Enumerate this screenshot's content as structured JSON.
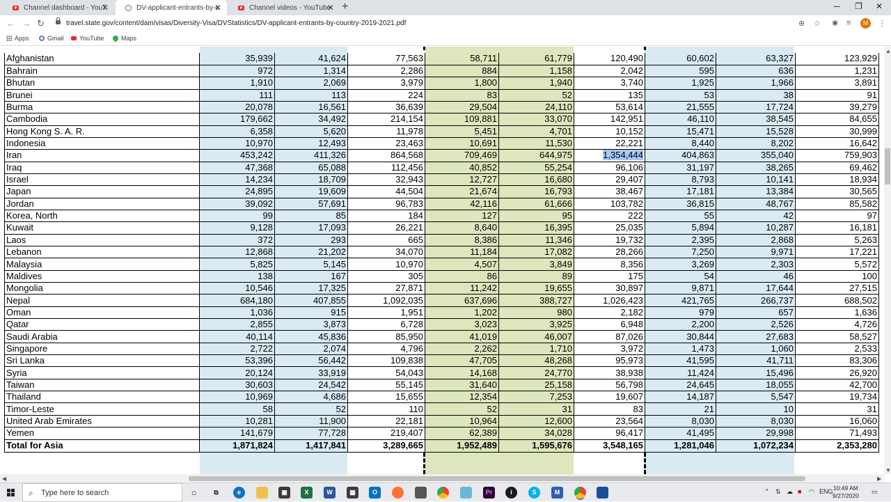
{
  "browser": {
    "tabs": [
      {
        "title": "Channel dashboard - YouTube Studio",
        "icon": "youtube-icon",
        "active": false
      },
      {
        "title": "DV-applicant-entrants-by-country",
        "icon": "globe-icon",
        "active": true
      },
      {
        "title": "Channel videos - YouTube Studio",
        "icon": "youtube-icon",
        "active": false
      }
    ],
    "url": "travel.state.gov/content/dam/visas/Diversity-Visa/DVStatistics/DV-applicant-entrants-by-country-2019-2021.pdf",
    "profile_initial": "M",
    "bookmarks": [
      {
        "label": "Apps",
        "icon": "apps-grid-icon"
      },
      {
        "label": "Gmail",
        "icon": "google-icon"
      },
      {
        "label": "YouTube",
        "icon": "youtube-icon"
      },
      {
        "label": "Maps",
        "icon": "maps-pin-icon"
      }
    ]
  },
  "table": {
    "rows": [
      {
        "country": "Afghanistan",
        "values": [
          "35,939",
          "41,624",
          "77,563",
          "58,711",
          "61,779",
          "120,490",
          "60,602",
          "63,327",
          "123,929"
        ]
      },
      {
        "country": "Bahrain",
        "values": [
          "972",
          "1,314",
          "2,286",
          "884",
          "1,158",
          "2,042",
          "595",
          "636",
          "1,231"
        ]
      },
      {
        "country": "Bhutan",
        "values": [
          "1,910",
          "2,069",
          "3,979",
          "1,800",
          "1,940",
          "3,740",
          "1,925",
          "1,966",
          "3,891"
        ]
      },
      {
        "country": "Brunei",
        "values": [
          "111",
          "113",
          "224",
          "83",
          "52",
          "135",
          "53",
          "38",
          "91"
        ]
      },
      {
        "country": "Burma",
        "values": [
          "20,078",
          "16,561",
          "36,639",
          "29,504",
          "24,110",
          "53,614",
          "21,555",
          "17,724",
          "39,279"
        ]
      },
      {
        "country": "Cambodia",
        "values": [
          "179,662",
          "34,492",
          "214,154",
          "109,881",
          "33,070",
          "142,951",
          "46,110",
          "38,545",
          "84,655"
        ]
      },
      {
        "country": "Hong Kong S. A. R.",
        "values": [
          "6,358",
          "5,620",
          "11,978",
          "5,451",
          "4,701",
          "10,152",
          "15,471",
          "15,528",
          "30,999"
        ]
      },
      {
        "country": "Indonesia",
        "values": [
          "10,970",
          "12,493",
          "23,463",
          "10,691",
          "11,530",
          "22,221",
          "8,440",
          "8,202",
          "16,642"
        ]
      },
      {
        "country": "Iran",
        "values": [
          "453,242",
          "411,326",
          "864,568",
          "709,469",
          "644,975",
          "1,354,444",
          "404,863",
          "355,040",
          "759,903"
        ]
      },
      {
        "country": "Iraq",
        "values": [
          "47,368",
          "65,088",
          "112,456",
          "40,852",
          "55,254",
          "96,106",
          "31,197",
          "38,265",
          "69,462"
        ]
      },
      {
        "country": "Israel",
        "values": [
          "14,234",
          "18,709",
          "32,943",
          "12,727",
          "16,680",
          "29,407",
          "8,793",
          "10,141",
          "18,934"
        ]
      },
      {
        "country": "Japan",
        "values": [
          "24,895",
          "19,609",
          "44,504",
          "21,674",
          "16,793",
          "38,467",
          "17,181",
          "13,384",
          "30,565"
        ]
      },
      {
        "country": "Jordan",
        "values": [
          "39,092",
          "57,691",
          "96,783",
          "42,116",
          "61,666",
          "103,782",
          "36,815",
          "48,767",
          "85,582"
        ]
      },
      {
        "country": "Korea, North",
        "values": [
          "99",
          "85",
          "184",
          "127",
          "95",
          "222",
          "55",
          "42",
          "97"
        ]
      },
      {
        "country": "Kuwait",
        "values": [
          "9,128",
          "17,093",
          "26,221",
          "8,640",
          "16,395",
          "25,035",
          "5,894",
          "10,287",
          "16,181"
        ]
      },
      {
        "country": "Laos",
        "values": [
          "372",
          "293",
          "665",
          "8,386",
          "11,346",
          "19,732",
          "2,395",
          "2,868",
          "5,263"
        ]
      },
      {
        "country": "Lebanon",
        "values": [
          "12,868",
          "21,202",
          "34,070",
          "11,184",
          "17,082",
          "28,266",
          "7,250",
          "9,971",
          "17,221"
        ]
      },
      {
        "country": "Malaysia",
        "values": [
          "5,825",
          "5,145",
          "10,970",
          "4,507",
          "3,849",
          "8,356",
          "3,269",
          "2,303",
          "5,572"
        ]
      },
      {
        "country": "Maldives",
        "values": [
          "138",
          "167",
          "305",
          "86",
          "89",
          "175",
          "54",
          "46",
          "100"
        ]
      },
      {
        "country": "Mongolia",
        "values": [
          "10,546",
          "17,325",
          "27,871",
          "11,242",
          "19,655",
          "30,897",
          "9,871",
          "17,644",
          "27,515"
        ]
      },
      {
        "country": "Nepal",
        "values": [
          "684,180",
          "407,855",
          "1,092,035",
          "637,696",
          "388,727",
          "1,026,423",
          "421,765",
          "266,737",
          "688,502"
        ]
      },
      {
        "country": "Oman",
        "values": [
          "1,036",
          "915",
          "1,951",
          "1,202",
          "980",
          "2,182",
          "979",
          "657",
          "1,636"
        ]
      },
      {
        "country": "Qatar",
        "values": [
          "2,855",
          "3,873",
          "6,728",
          "3,023",
          "3,925",
          "6,948",
          "2,200",
          "2,526",
          "4,726"
        ]
      },
      {
        "country": "Saudi Arabia",
        "values": [
          "40,114",
          "45,836",
          "85,950",
          "41,019",
          "46,007",
          "87,026",
          "30,844",
          "27,683",
          "58,527"
        ]
      },
      {
        "country": "Singapore",
        "values": [
          "2,722",
          "2,074",
          "4,796",
          "2,262",
          "1,710",
          "3,972",
          "1,473",
          "1,060",
          "2,533"
        ]
      },
      {
        "country": "Sri Lanka",
        "values": [
          "53,396",
          "56,442",
          "109,838",
          "47,705",
          "48,268",
          "95,973",
          "41,595",
          "41,711",
          "83,306"
        ]
      },
      {
        "country": "Syria",
        "values": [
          "20,124",
          "33,919",
          "54,043",
          "14,168",
          "24,770",
          "38,938",
          "11,424",
          "15,496",
          "26,920"
        ]
      },
      {
        "country": "Taiwan",
        "values": [
          "30,603",
          "24,542",
          "55,145",
          "31,640",
          "25,158",
          "56,798",
          "24,645",
          "18,055",
          "42,700"
        ]
      },
      {
        "country": "Thailand",
        "values": [
          "10,969",
          "4,686",
          "15,655",
          "12,354",
          "7,253",
          "19,607",
          "14,187",
          "5,547",
          "19,734"
        ]
      },
      {
        "country": "Timor-Leste",
        "values": [
          "58",
          "52",
          "110",
          "52",
          "31",
          "83",
          "21",
          "10",
          "31"
        ]
      },
      {
        "country": "United Arab Emirates",
        "values": [
          "10,281",
          "11,900",
          "22,181",
          "10,964",
          "12,600",
          "23,564",
          "8,030",
          "8,030",
          "16,060"
        ]
      },
      {
        "country": "Yemen",
        "values": [
          "141,679",
          "77,728",
          "219,407",
          "62,389",
          "34,028",
          "96,417",
          "41,495",
          "29,998",
          "71,493"
        ]
      }
    ],
    "total": {
      "country": "Total for Asia",
      "values": [
        "1,871,824",
        "1,417,841",
        "3,289,665",
        "1,952,489",
        "1,595,676",
        "3,548,165",
        "1,281,046",
        "1,072,234",
        "2,353,280"
      ]
    },
    "selected_cell": "1,354,444",
    "colors": {
      "blue_band": "#daeaf3",
      "green_band": "#dde6bd",
      "selection": "#a8c7fa"
    }
  },
  "taskbar": {
    "search_placeholder": "Type here to search",
    "language": "ENG",
    "time": "10:49 AM",
    "date": "9/27/2020"
  }
}
